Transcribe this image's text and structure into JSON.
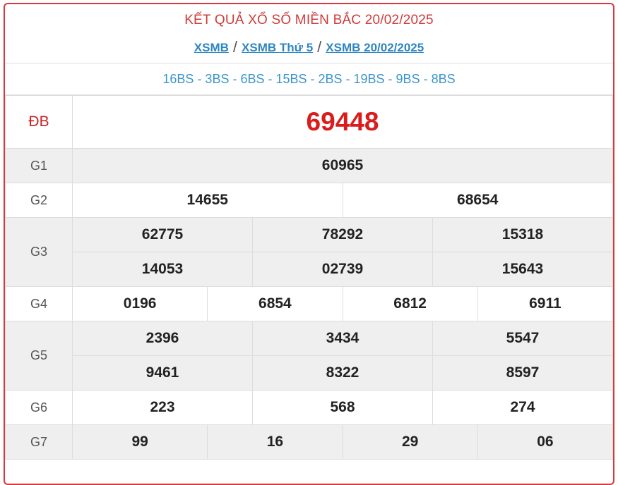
{
  "header": {
    "title": "KẾT QUẢ XỔ SỐ MIỀN BẮC 20/02/2025",
    "breadcrumb": [
      {
        "label": "XSMB"
      },
      {
        "label": "XSMB Thứ 5"
      },
      {
        "label": "XSMB 20/02/2025"
      }
    ],
    "separator": "/"
  },
  "codes": "16BS - 3BS - 6BS - 15BS - 2BS - 19BS - 9BS - 8BS",
  "prizes": {
    "db": {
      "label": "ĐB",
      "values": [
        "69448"
      ]
    },
    "g1": {
      "label": "G1",
      "values": [
        "60965"
      ]
    },
    "g2": {
      "label": "G2",
      "values": [
        "14655",
        "68654"
      ]
    },
    "g3": {
      "label": "G3",
      "values": [
        "62775",
        "78292",
        "15318",
        "14053",
        "02739",
        "15643"
      ]
    },
    "g4": {
      "label": "G4",
      "values": [
        "0196",
        "6854",
        "6812",
        "6911"
      ]
    },
    "g5": {
      "label": "G5",
      "values": [
        "2396",
        "3434",
        "5547",
        "9461",
        "8322",
        "8597"
      ]
    },
    "g6": {
      "label": "G6",
      "values": [
        "223",
        "568",
        "274"
      ]
    },
    "g7": {
      "label": "G7",
      "values": [
        "99",
        "16",
        "29",
        "06"
      ]
    }
  },
  "colors": {
    "border": "#d9363e",
    "title": "#cf3a3a",
    "link": "#2e86c1",
    "codes": "#3a95c9",
    "special": "#d91c1c",
    "row_alt": "#efefef"
  }
}
